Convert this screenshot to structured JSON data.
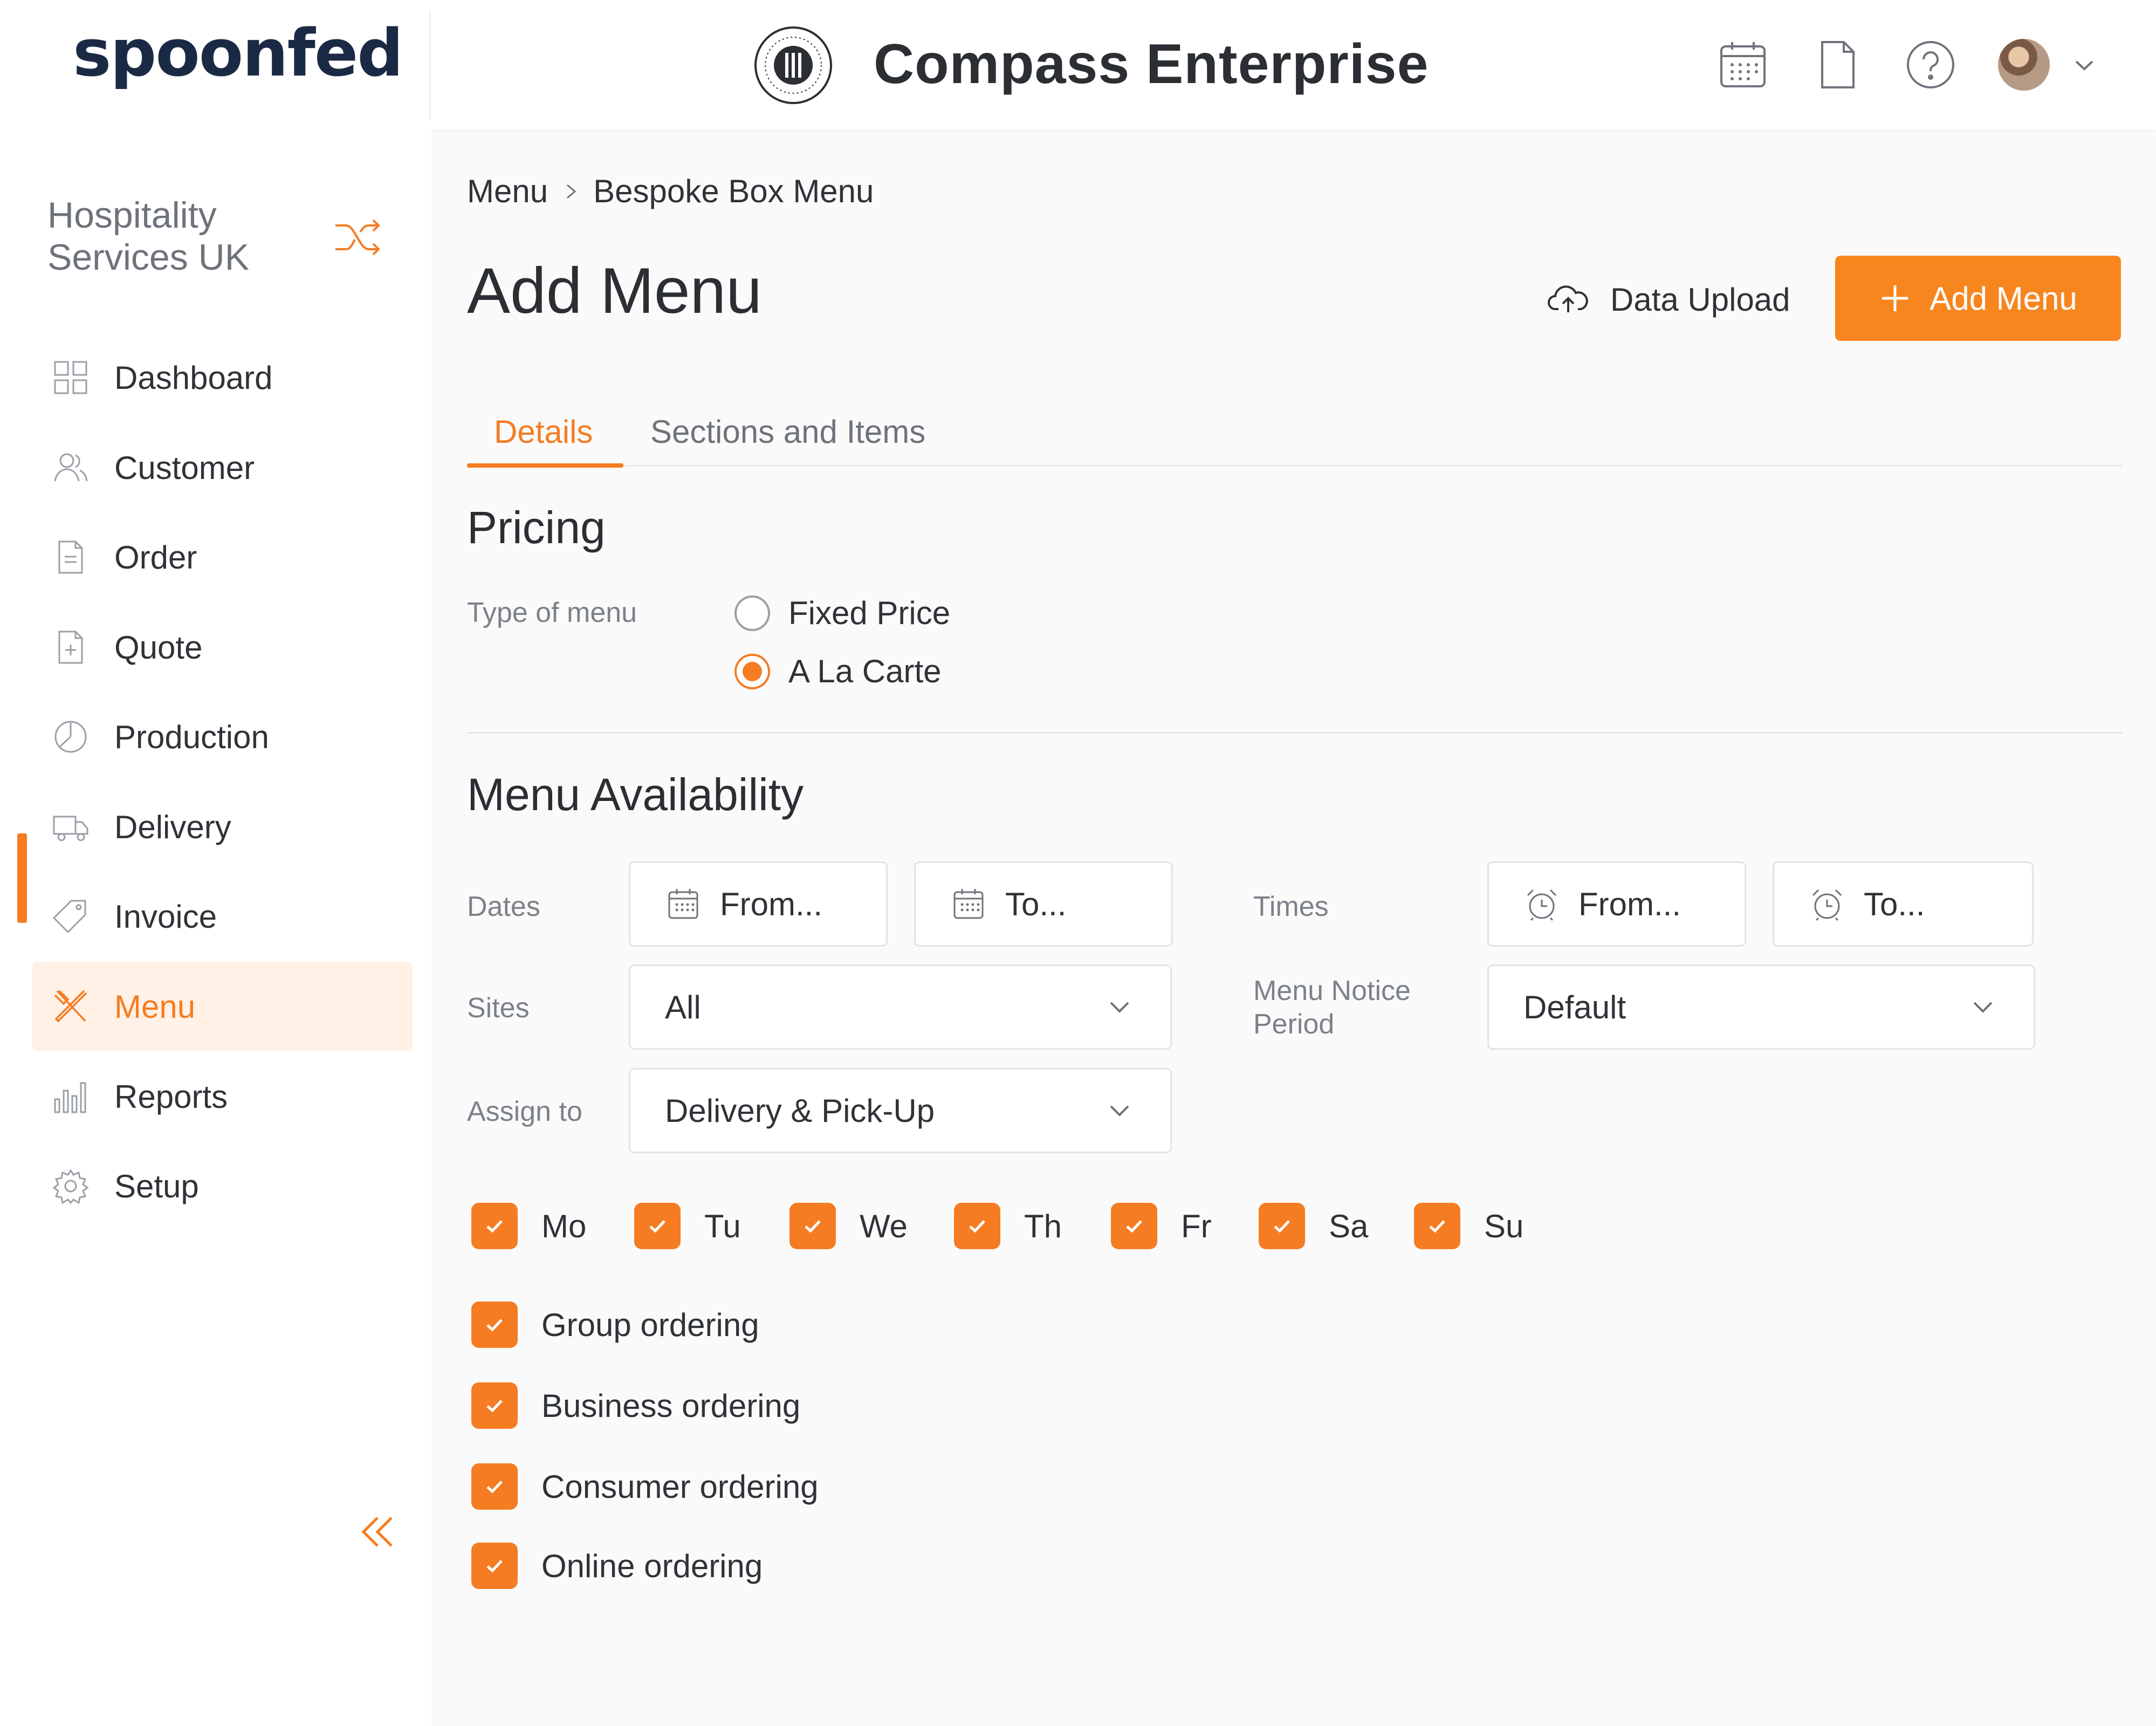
{
  "header": {
    "logo": "spoonfed",
    "brand_title": "Compass Enterprise",
    "icons": [
      "calendar-icon",
      "document-icon",
      "help-icon",
      "avatar",
      "chevron-down-icon"
    ]
  },
  "sidebar": {
    "org_name_line1": "Hospitality",
    "org_name_line2": "Services UK",
    "items": [
      {
        "label": "Dashboard",
        "icon": "grid-icon"
      },
      {
        "label": "Customer",
        "icon": "users-icon"
      },
      {
        "label": "Order",
        "icon": "document-icon"
      },
      {
        "label": "Quote",
        "icon": "document-plus-icon"
      },
      {
        "label": "Production",
        "icon": "pie-chart-icon"
      },
      {
        "label": "Delivery",
        "icon": "truck-icon"
      },
      {
        "label": "Invoice",
        "icon": "tag-icon"
      },
      {
        "label": "Menu",
        "icon": "cutlery-icon",
        "active": true
      },
      {
        "label": "Reports",
        "icon": "bar-chart-icon"
      },
      {
        "label": "Setup",
        "icon": "gear-icon"
      }
    ]
  },
  "breadcrumb": {
    "parent": "Menu",
    "current": "Bespoke Box Menu"
  },
  "page": {
    "title": "Add Menu",
    "data_upload_label": "Data Upload",
    "add_button_label": "Add Menu"
  },
  "tabs": [
    {
      "label": "Details",
      "active": true
    },
    {
      "label": "Sections and Items",
      "active": false
    }
  ],
  "pricing": {
    "title": "Pricing",
    "type_label": "Type of menu",
    "options": [
      {
        "label": "Fixed Price",
        "selected": false
      },
      {
        "label": "A La Carte",
        "selected": true
      }
    ]
  },
  "availability": {
    "title": "Menu Availability",
    "dates_label": "Dates",
    "date_from_placeholder": "From...",
    "date_to_placeholder": "To...",
    "times_label": "Times",
    "time_from_placeholder": "From...",
    "time_to_placeholder": "To...",
    "sites_label": "Sites",
    "sites_value": "All",
    "notice_label_line1": "Menu Notice",
    "notice_label_line2": "Period",
    "notice_value": "Default",
    "assign_label": "Assign to",
    "assign_value": "Delivery & Pick-Up",
    "days": [
      {
        "label": "Mo",
        "checked": true
      },
      {
        "label": "Tu",
        "checked": true
      },
      {
        "label": "We",
        "checked": true
      },
      {
        "label": "Th",
        "checked": true
      },
      {
        "label": "Fr",
        "checked": true
      },
      {
        "label": "Sa",
        "checked": true
      },
      {
        "label": "Su",
        "checked": true
      }
    ],
    "ordering": [
      {
        "label": "Group ordering",
        "checked": true
      },
      {
        "label": "Business ordering",
        "checked": true
      },
      {
        "label": "Consumer ordering",
        "checked": true
      },
      {
        "label": "Online ordering",
        "checked": true
      }
    ]
  },
  "colors": {
    "accent": "#F57C22",
    "accent_button": "#F7861F",
    "active_bg": "#FFF1E6",
    "text": "#2B2E33",
    "muted": "#7C8189"
  }
}
